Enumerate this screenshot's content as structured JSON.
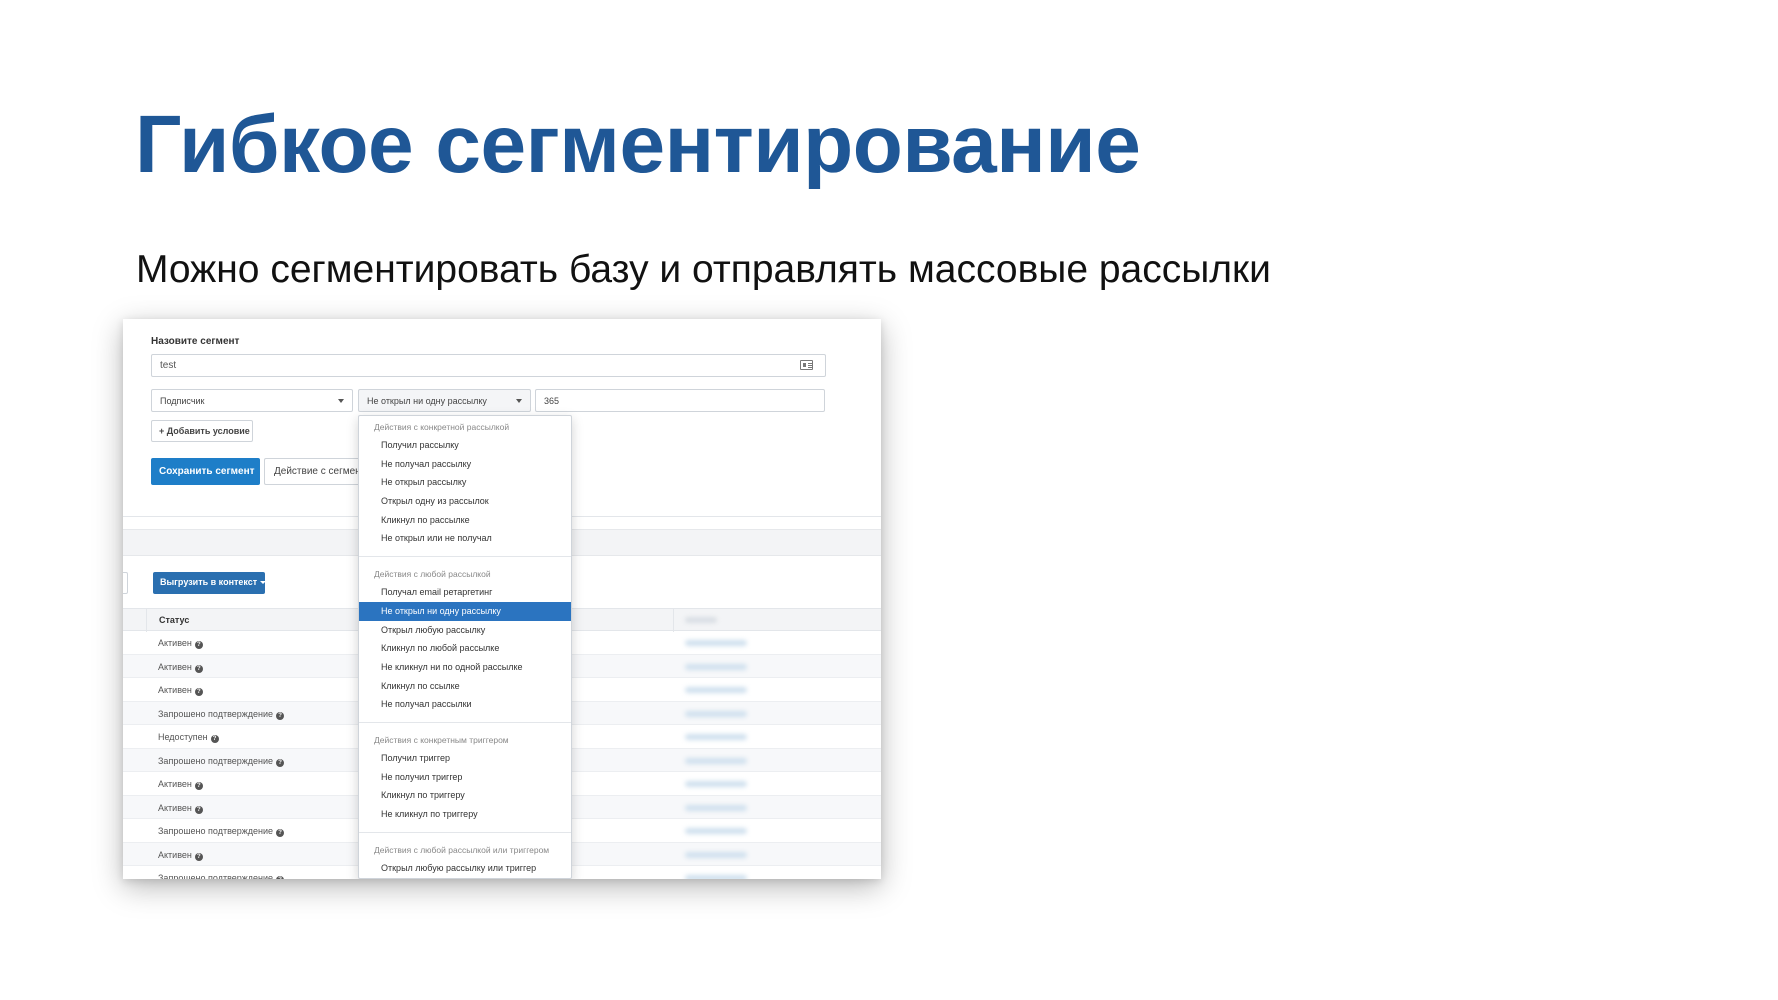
{
  "slide": {
    "title": "Гибкое сегментирование",
    "subtitle": "Можно сегментировать базу и отправлять массовые рассылки"
  },
  "form": {
    "segment_label": "Назовите сегмент",
    "segment_name_value": "test",
    "subscriber_select": "Подписчик",
    "action_select": "Не открыл ни одну рассылку",
    "days_value": "365",
    "add_condition_label": "+ Добавить условие",
    "save_label": "Сохранить сегмент",
    "segment_action_label": "Действие с сегментом"
  },
  "toolbar": {
    "export_label": "Выгрузить в контекст"
  },
  "table": {
    "status_header": "Статус",
    "rows": [
      {
        "status": "Активен"
      },
      {
        "status": "Активен"
      },
      {
        "status": "Активен"
      },
      {
        "status": "Запрошено подтверждение"
      },
      {
        "status": "Недоступен"
      },
      {
        "status": "Запрошено подтверждение"
      },
      {
        "status": "Активен"
      },
      {
        "status": "Активен"
      },
      {
        "status": "Запрошено подтверждение"
      },
      {
        "status": "Активен"
      },
      {
        "status": "Запрошено подтверждение"
      }
    ]
  },
  "dropdown": {
    "groups": [
      {
        "header": "Действия с конкретной рассылкой",
        "items": [
          "Получил рассылку",
          "Не получал рассылку",
          "Не открыл рассылку",
          "Открыл одну из рассылок",
          "Кликнул по рассылке",
          "Не открыл или не получал"
        ]
      },
      {
        "header": "Действия с любой рассылкой",
        "items": [
          "Получал email ретаргетинг",
          "Не открыл ни одну рассылку",
          "Открыл любую рассылку",
          "Кликнул по любой рассылке",
          "Не кликнул ни по одной рассылке",
          "Кликнул по ссылке",
          "Не получал рассылки"
        ]
      },
      {
        "header": "Действия с конкретным триггером",
        "items": [
          "Получил триггер",
          "Не получил триггер",
          "Кликнул по триггеру",
          "Не кликнул по триггеру"
        ]
      },
      {
        "header": "Действия с любой рассылкой или триггером",
        "items": [
          "Открыл любую рассылку или триггер"
        ]
      }
    ],
    "selected": "Не открыл ни одну рассылку"
  },
  "colors": {
    "title": "#1f5796",
    "primary_button": "#1e7ec8",
    "selected_item": "#2b74c0"
  }
}
